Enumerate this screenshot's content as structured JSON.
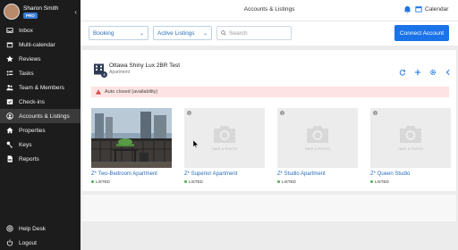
{
  "user": {
    "name": "Sharon Smith",
    "badge": "PRO"
  },
  "sidebar": {
    "items": [
      {
        "label": "Inbox",
        "icon": "inbox-icon"
      },
      {
        "label": "Multi-calendar",
        "icon": "calendar-icon"
      },
      {
        "label": "Reviews",
        "icon": "star-icon"
      },
      {
        "label": "Tasks",
        "icon": "tasks-icon"
      },
      {
        "label": "Team & Members",
        "icon": "team-icon"
      },
      {
        "label": "Check-ins",
        "icon": "checkin-icon"
      },
      {
        "label": "Accounts & Listings",
        "icon": "accounts-icon",
        "active": true
      },
      {
        "label": "Properties",
        "icon": "home-icon"
      },
      {
        "label": "Keys",
        "icon": "key-icon"
      },
      {
        "label": "Reports",
        "icon": "reports-icon"
      }
    ],
    "bottom": [
      {
        "label": "Help Desk",
        "icon": "help-icon"
      },
      {
        "label": "Logout",
        "icon": "power-icon"
      }
    ]
  },
  "topbar": {
    "title": "Accounts & Listings",
    "calendar_label": "Calendar"
  },
  "filters": {
    "booking": "Booking",
    "active": "Active Listings",
    "search_placeholder": "Search",
    "connect_label": "Connect Account"
  },
  "listing": {
    "name": "Ottawa Shiny Lux 2BR Test",
    "type": "Apartment",
    "count": "4",
    "alert": "Auto closed (availability)"
  },
  "units": [
    {
      "name": "Z* Two-Bedroom Apartment",
      "status": "LISTED",
      "has_photo": true
    },
    {
      "name": "Z* Superior Apartment",
      "status": "LISTED",
      "has_photo": false
    },
    {
      "name": "Z* Studio Apartment",
      "status": "LISTED",
      "has_photo": false
    },
    {
      "name": "Z* Queen Studio",
      "status": "LISTED",
      "has_photo": false
    }
  ],
  "placeholder_label": "TAKE A PHOTO",
  "colors": {
    "primary": "#1a73e8",
    "sidebar": "#1c1c1c",
    "alert_bg": "#fde3e3",
    "listed": "#4caf50"
  }
}
